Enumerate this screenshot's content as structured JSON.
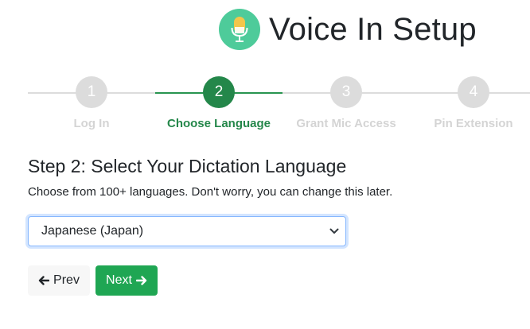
{
  "header": {
    "title": "Voice In Setup",
    "logo_icon": "microphone-icon",
    "logo_color": "#4ecb9a"
  },
  "stepper": {
    "steps": [
      {
        "number": "1",
        "label": "Log In",
        "state": "inactive"
      },
      {
        "number": "2",
        "label": "Choose Language",
        "state": "active"
      },
      {
        "number": "3",
        "label": "Grant Mic Access",
        "state": "inactive"
      },
      {
        "number": "4",
        "label": "Pin Extension",
        "state": "inactive"
      }
    ],
    "active_color": "#24874a",
    "inactive_color": "#dcdcdc"
  },
  "main": {
    "heading": "Step 2: Select Your Dictation Language",
    "description": "Choose from 100+ languages. Don't worry, you can change this later.",
    "language_select": {
      "selected": "Japanese (Japan)"
    }
  },
  "nav": {
    "prev_label": "Prev",
    "prev_icon": "arrow-left-icon",
    "next_label": "Next",
    "next_icon": "arrow-right-icon",
    "next_color": "#1fa653"
  }
}
